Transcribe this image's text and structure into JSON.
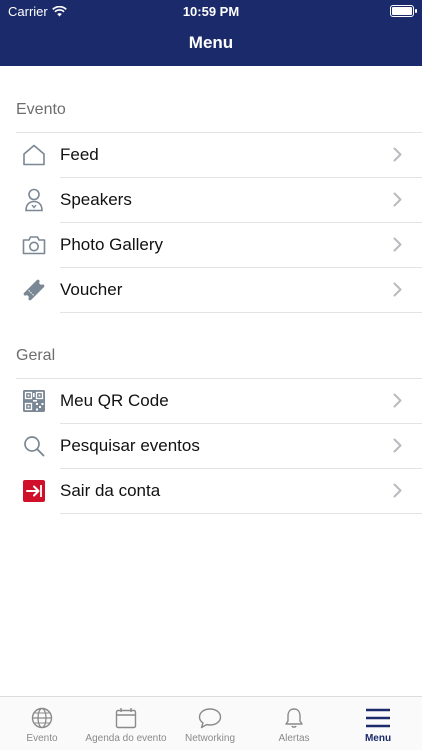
{
  "status_bar": {
    "carrier": "Carrier",
    "time": "10:59 PM"
  },
  "header": {
    "title": "Menu"
  },
  "sections": [
    {
      "title": "Evento",
      "items": [
        {
          "label": "Feed",
          "icon": "home-icon"
        },
        {
          "label": "Speakers",
          "icon": "person-icon"
        },
        {
          "label": "Photo Gallery",
          "icon": "camera-icon"
        },
        {
          "label": "Voucher",
          "icon": "ticket-icon"
        }
      ]
    },
    {
      "title": "Geral",
      "items": [
        {
          "label": "Meu QR Code",
          "icon": "qr-code-icon"
        },
        {
          "label": "Pesquisar eventos",
          "icon": "search-icon"
        },
        {
          "label": "Sair da conta",
          "icon": "logout-icon"
        }
      ]
    }
  ],
  "tabbar": {
    "items": [
      {
        "label": "Evento",
        "icon": "globe-icon"
      },
      {
        "label": "Agenda do evento",
        "icon": "calendar-icon"
      },
      {
        "label": "Networking",
        "icon": "chat-bubble-icon"
      },
      {
        "label": "Alertas",
        "icon": "bell-icon"
      },
      {
        "label": "Menu",
        "icon": "menu-icon",
        "active": true
      }
    ]
  },
  "colors": {
    "brand": "#1b2a6b",
    "logout": "#d0102a",
    "icon_gray": "#7a8794"
  }
}
